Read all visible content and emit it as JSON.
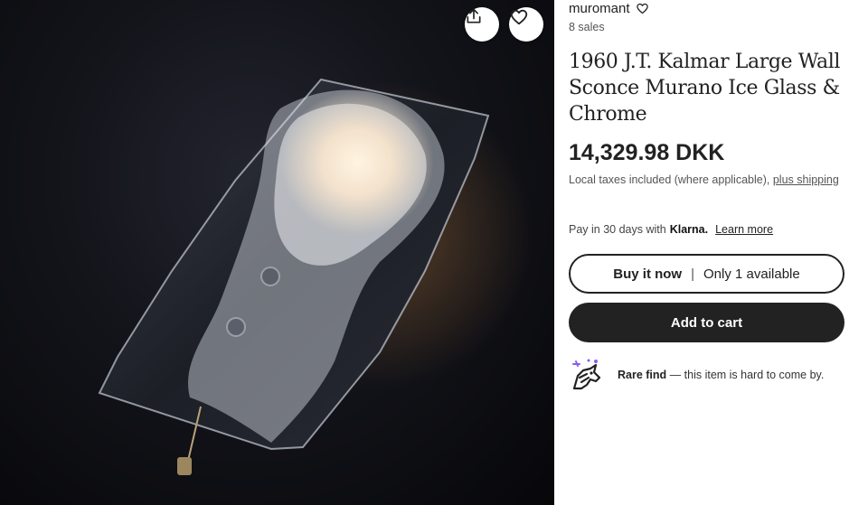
{
  "product_image": {
    "alt_icon": "murano-ice-glass-sconce-photo",
    "share_icon": "share-icon",
    "favorite_icon": "heart-icon"
  },
  "shop": {
    "name": "muromant",
    "follow_icon": "heart-outline-icon",
    "sales": "8 sales"
  },
  "listing": {
    "title": "1960 J.T. Kalmar Large Wall Sconce Murano Ice Glass & Chrome",
    "price": "14,329.98 DKK",
    "taxes_text": "Local taxes included (where applicable),",
    "shipping_link": "plus shipping"
  },
  "klarna": {
    "prefix": "Pay in 30 days with",
    "brand": "Klarna.",
    "learn_more": "Learn more"
  },
  "actions": {
    "buy_now": "Buy it now",
    "separator": "|",
    "availability": "Only 1 available",
    "add_to_cart": "Add to cart"
  },
  "rare_find": {
    "icon": "rare-find-unicorn-icon",
    "label": "Rare find",
    "text": "— this item is hard to come by."
  },
  "colors": {
    "text": "#222222",
    "button_dark": "#222222",
    "rare_icon_accent": "#8a5cf6"
  }
}
